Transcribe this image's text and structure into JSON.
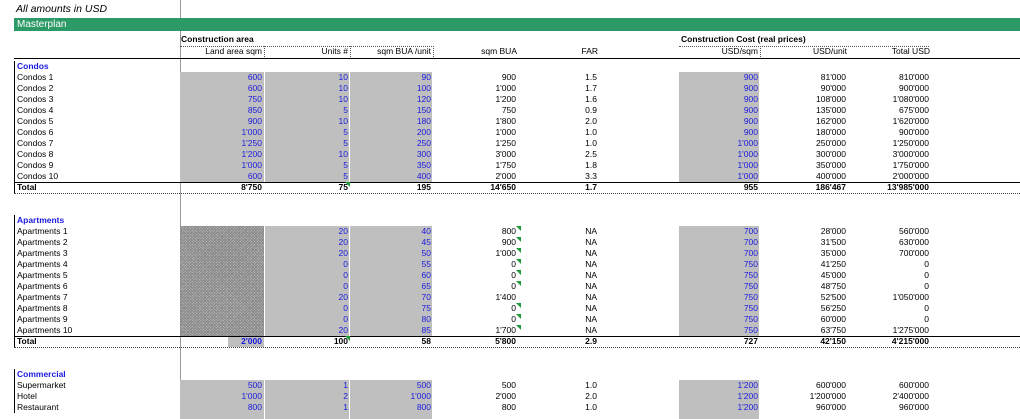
{
  "note": "All amounts in USD",
  "banner": "Masterplan",
  "groups": {
    "construction_area": "Construction area",
    "construction_cost": "Construction Cost (real prices)"
  },
  "headers": [
    "Land area sqm",
    "Units #",
    "sqm BUA /unit",
    "sqm BUA",
    "FAR",
    "USD/sqm",
    "USD/unit",
    "Total USD"
  ],
  "sections": [
    {
      "title": "Condos",
      "rows": [
        [
          "Condos 1",
          "600",
          "10",
          "90",
          "900",
          "1.5",
          "900",
          "81'000",
          "810'000"
        ],
        [
          "Condos 2",
          "600",
          "10",
          "100",
          "1'000",
          "1.7",
          "900",
          "90'000",
          "900'000"
        ],
        [
          "Condos 3",
          "750",
          "10",
          "120",
          "1'200",
          "1.6",
          "900",
          "108'000",
          "1'080'000"
        ],
        [
          "Condos 4",
          "850",
          "5",
          "150",
          "750",
          "0.9",
          "900",
          "135'000",
          "675'000"
        ],
        [
          "Condos 5",
          "900",
          "10",
          "180",
          "1'800",
          "2.0",
          "900",
          "162'000",
          "1'620'000"
        ],
        [
          "Condos 6",
          "1'000",
          "5",
          "200",
          "1'000",
          "1.0",
          "900",
          "180'000",
          "900'000"
        ],
        [
          "Condos 7",
          "1'250",
          "5",
          "250",
          "1'250",
          "1.0",
          "1'000",
          "250'000",
          "1'250'000"
        ],
        [
          "Condos 8",
          "1'200",
          "10",
          "300",
          "3'000",
          "2.5",
          "1'000",
          "300'000",
          "3'000'000"
        ],
        [
          "Condos 9",
          "1'000",
          "5",
          "350",
          "1'750",
          "1.8",
          "1'000",
          "350'000",
          "1'750'000"
        ],
        [
          "Condos 10",
          "600",
          "5",
          "400",
          "2'000",
          "3.3",
          "1'000",
          "400'000",
          "2'000'000"
        ]
      ],
      "total": [
        "Total",
        "8'750",
        "75",
        "195",
        "14'650",
        "1.7",
        "955",
        "186'467",
        "13'985'000"
      ]
    },
    {
      "title": "Apartments",
      "rows": [
        [
          "Apartments 1",
          "",
          "20",
          "40",
          "800",
          "NA",
          "700",
          "28'000",
          "560'000"
        ],
        [
          "Apartments 2",
          "",
          "20",
          "45",
          "900",
          "NA",
          "700",
          "31'500",
          "630'000"
        ],
        [
          "Apartments 3",
          "",
          "20",
          "50",
          "1'000",
          "NA",
          "700",
          "35'000",
          "700'000"
        ],
        [
          "Apartments 4",
          "",
          "0",
          "55",
          "0",
          "NA",
          "750",
          "41'250",
          "0"
        ],
        [
          "Apartments 5",
          "",
          "0",
          "60",
          "0",
          "NA",
          "750",
          "45'000",
          "0"
        ],
        [
          "Apartments 6",
          "",
          "0",
          "65",
          "0",
          "NA",
          "750",
          "48'750",
          "0"
        ],
        [
          "Apartments 7",
          "",
          "20",
          "70",
          "1'400",
          "NA",
          "750",
          "52'500",
          "1'050'000"
        ],
        [
          "Apartments 8",
          "",
          "0",
          "75",
          "0",
          "NA",
          "750",
          "56'250",
          "0"
        ],
        [
          "Apartments 9",
          "",
          "0",
          "80",
          "0",
          "NA",
          "750",
          "60'000",
          "0"
        ],
        [
          "Apartments 10",
          "",
          "20",
          "85",
          "1'700",
          "NA",
          "750",
          "63'750",
          "1'275'000"
        ]
      ],
      "total": [
        "Total",
        "2'000",
        "100",
        "58",
        "5'800",
        "2.9",
        "727",
        "42'150",
        "4'215'000"
      ]
    },
    {
      "title": "Commercial",
      "rows": [
        [
          "Supermarket",
          "500",
          "1",
          "500",
          "500",
          "1.0",
          "1'200",
          "600'000",
          "600'000"
        ],
        [
          "Hotel",
          "1'000",
          "2",
          "1'000",
          "2'000",
          "2.0",
          "1'200",
          "1'200'000",
          "2'400'000"
        ],
        [
          "Restaurant",
          "800",
          "1",
          "800",
          "800",
          "1.0",
          "1'200",
          "960'000",
          "960'000"
        ]
      ]
    }
  ]
}
